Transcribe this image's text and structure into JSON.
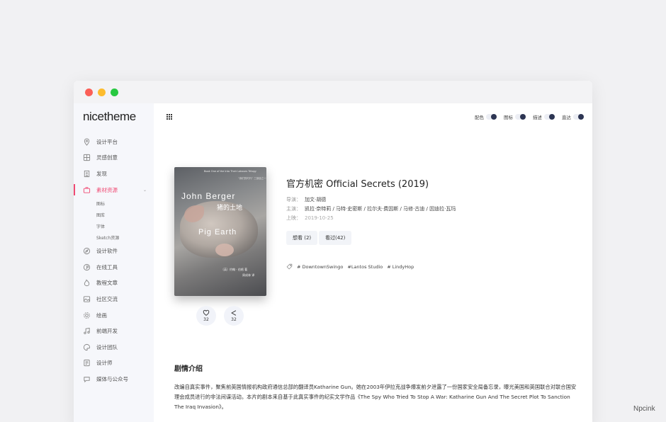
{
  "sidebar": {
    "brand": "nicetheme",
    "items": [
      {
        "label": "设计平台",
        "icon": "location-icon"
      },
      {
        "label": "灵感创意",
        "icon": "grid-icon"
      },
      {
        "label": "发现",
        "icon": "building-icon"
      },
      {
        "label": "素材资源",
        "icon": "briefcase-icon",
        "active": true,
        "children": [
          "图标",
          "图库",
          "字体",
          "Sketch资源"
        ]
      },
      {
        "label": "设计软件",
        "icon": "compass-icon"
      },
      {
        "label": "在线工具",
        "icon": "pinterest-icon"
      },
      {
        "label": "教程文章",
        "icon": "flame-icon"
      },
      {
        "label": "社区交流",
        "icon": "image-icon"
      },
      {
        "label": "绘画",
        "icon": "gear-icon"
      },
      {
        "label": "前端开发",
        "icon": "music-icon"
      },
      {
        "label": "设计团队",
        "icon": "palette-icon"
      },
      {
        "label": "设计师",
        "icon": "folder-icon"
      },
      {
        "label": "媒体与公众号",
        "icon": "chat-icon"
      }
    ]
  },
  "topbar": {
    "menu_icon": "apps-grid-icon",
    "toggles": [
      {
        "label": "配色"
      },
      {
        "label": "图标"
      },
      {
        "label": "描述"
      },
      {
        "label": "直达"
      }
    ]
  },
  "book": {
    "cover": {
      "series": "Book One of the Into Their Labours Trilogy",
      "tag": "“我们的时代” 三部曲之一",
      "author": "John Berger",
      "cn_title": "猪的土地",
      "en_title": "Pig Earth",
      "credit1": "〔英〕约翰 · 伯格 著",
      "credit2": "周成林 译"
    },
    "like_count": "32",
    "share_count": "32",
    "title": "官方机密 Official Secrets (2019)",
    "director_label": "导演：",
    "director": "加文·胡德",
    "cast_label": "主演：",
    "cast": "凯拉·奈特莉 / 马特·史密斯 / 拉尔夫·费因斯 / 马修·古迪 / 因迪拉·瓦玛",
    "release_label": "上映：",
    "release": "2019-10-25",
    "want_button": "想看 (2)",
    "seen_button": "看过(42)",
    "tags": [
      "# DowntownSwingo",
      "#Lantos Studio",
      "# LindyHop"
    ]
  },
  "synopsis": {
    "heading": "剧情介绍",
    "text": "改编自真实事件，聚焦前英国情报机构政府通信总部的翻译员Katharine Gun。她在2003年伊拉克战争爆发前夕泄露了一份国家安全局备忘录，曝光美国和英国联合对联合国安理会成员进行的非法间谍活动。本片的剧本来自基于此真实事件的纪实文学作品《The Spy Who Tried To Stop A War: Katharine Gun And The Secret Plot To Sanction The Iraq Invasion》。"
  },
  "watermark": "Npcink"
}
